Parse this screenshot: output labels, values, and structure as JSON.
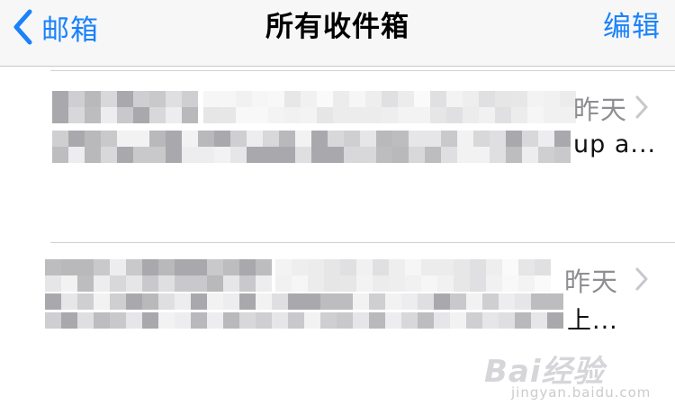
{
  "navbar": {
    "back_label": "邮箱",
    "title": "所有收件箱",
    "edit_label": "编辑"
  },
  "mails": [
    {
      "date": "昨天",
      "snippet_tail": "up a..."
    },
    {
      "date": "昨天",
      "snippet_tail": "上..."
    }
  ],
  "watermark": {
    "brand": "Bai经验",
    "sub": "jingyan.baidu.com"
  },
  "colors": {
    "accent": "#1a82fb",
    "secondary_text": "#8e8e93",
    "navbar_bg": "#f7f7f8",
    "chevron": "#c7c7cc"
  }
}
